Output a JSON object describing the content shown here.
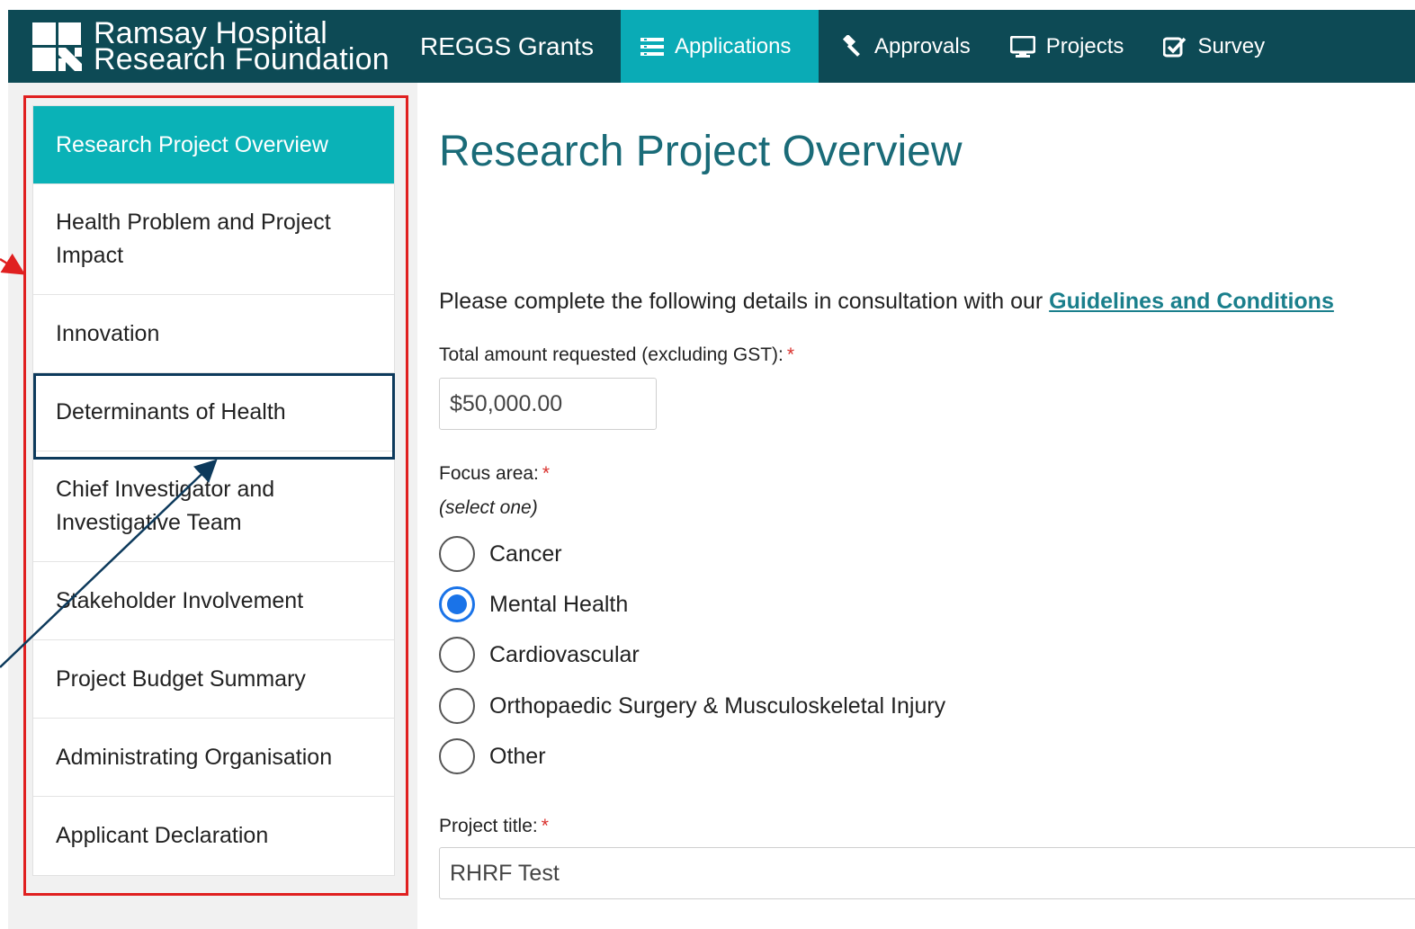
{
  "header": {
    "logo_line1": "Ramsay Hospital",
    "logo_line2": "Research Foundation",
    "brand": "REGGS Grants",
    "nav": [
      {
        "label": "Applications",
        "icon": "list-icon",
        "active": true
      },
      {
        "label": "Approvals",
        "icon": "gavel-icon",
        "active": false
      },
      {
        "label": "Projects",
        "icon": "monitor-icon",
        "active": false
      },
      {
        "label": "Survey",
        "icon": "check-square-icon",
        "active": false
      }
    ]
  },
  "sidebar": {
    "items": [
      {
        "label": "Research Project Overview",
        "active": true
      },
      {
        "label": "Health Problem and Project Impact"
      },
      {
        "label": "Innovation"
      },
      {
        "label": "Determinants of Health"
      },
      {
        "label": "Chief Investigator and Investigative Team"
      },
      {
        "label": "Stakeholder Involvement"
      },
      {
        "label": "Project Budget Summary"
      },
      {
        "label": "Administrating Organisation"
      },
      {
        "label": "Applicant Declaration"
      }
    ]
  },
  "main": {
    "title": "Research Project Overview",
    "intro_text": "Please complete the following details in consultation with our ",
    "intro_link": "Guidelines and Conditions",
    "amount_label": "Total amount requested (excluding GST):",
    "required_mark": "*",
    "amount_value": "$50,000.00",
    "focus_label": "Focus area:",
    "focus_hint": "(select one)",
    "focus_options": [
      {
        "label": "Cancer",
        "checked": false
      },
      {
        "label": "Mental Health",
        "checked": true
      },
      {
        "label": "Cardiovascular",
        "checked": false
      },
      {
        "label": "Orthopaedic Surgery & Musculoskeletal Injury",
        "checked": false
      },
      {
        "label": "Other",
        "checked": false
      }
    ],
    "project_title_label": "Project title:",
    "project_title_value": "RHRF Test"
  },
  "colors": {
    "topbar": "#0d4a55",
    "accent": "#0aabb6",
    "title": "#1a6b78",
    "annotation_red": "#e02020",
    "annotation_navy": "#0d3a5c",
    "radio_checked": "#1a73e8"
  }
}
